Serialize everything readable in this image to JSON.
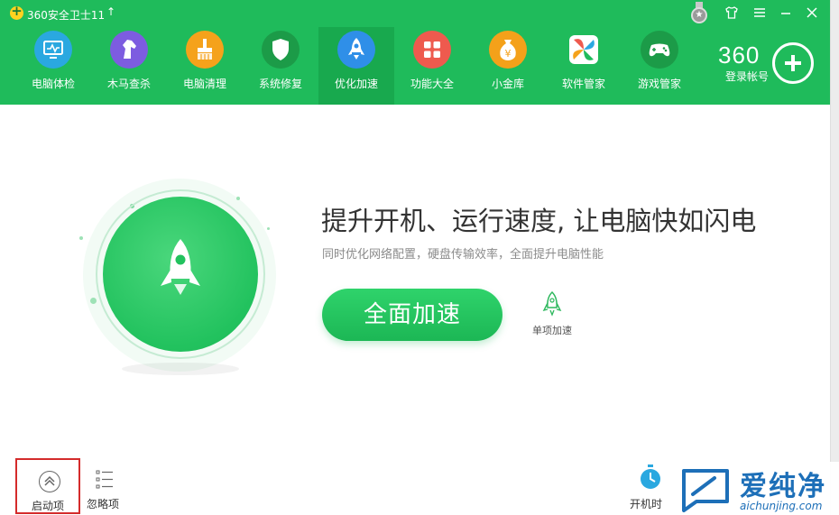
{
  "window": {
    "title": "360安全卫士11",
    "controls": {
      "skin": "shirt-icon",
      "menu": "menu-icon",
      "minimize": "minimize-icon",
      "close": "close-icon"
    }
  },
  "nav": {
    "items": [
      {
        "label": "电脑体检",
        "icon": "monitor-icon",
        "color": "#2aa8e0"
      },
      {
        "label": "木马查杀",
        "icon": "horse-icon",
        "color": "#7d5ce0"
      },
      {
        "label": "电脑清理",
        "icon": "broom-icon",
        "color": "#f5a21b"
      },
      {
        "label": "系统修复",
        "icon": "shield-icon",
        "color": "#1c9b48"
      },
      {
        "label": "优化加速",
        "icon": "rocket-icon",
        "color": "#2f8fe8",
        "active": true
      },
      {
        "label": "功能大全",
        "icon": "grid-icon",
        "color": "#ee5a4e"
      },
      {
        "label": "小金库",
        "icon": "money-bag-icon",
        "color": "#f4a11a"
      },
      {
        "label": "软件管家",
        "icon": "pinwheel-icon",
        "color": "#f0f0f0"
      },
      {
        "label": "游戏管家",
        "icon": "gamepad-icon",
        "color": "#1c9b48"
      }
    ]
  },
  "account": {
    "brand": "360",
    "login_label": "登录帐号"
  },
  "hero": {
    "headline": "提升开机、运行速度, 让电脑快如闪电",
    "subline": "同时优化网络配置，硬盘传输效率，全面提升电脑性能",
    "primary_button": "全面加速",
    "secondary_button": "单项加速"
  },
  "bottom": {
    "startup_label": "启动项",
    "ignore_label": "忽略项",
    "boottime_label": "开机时"
  },
  "watermark": {
    "title": "爱纯净",
    "url": "aichunjing.com"
  },
  "colors": {
    "header": "#1fbb5b",
    "accent": "#22c25e",
    "highlight_border": "#d42b2b"
  }
}
